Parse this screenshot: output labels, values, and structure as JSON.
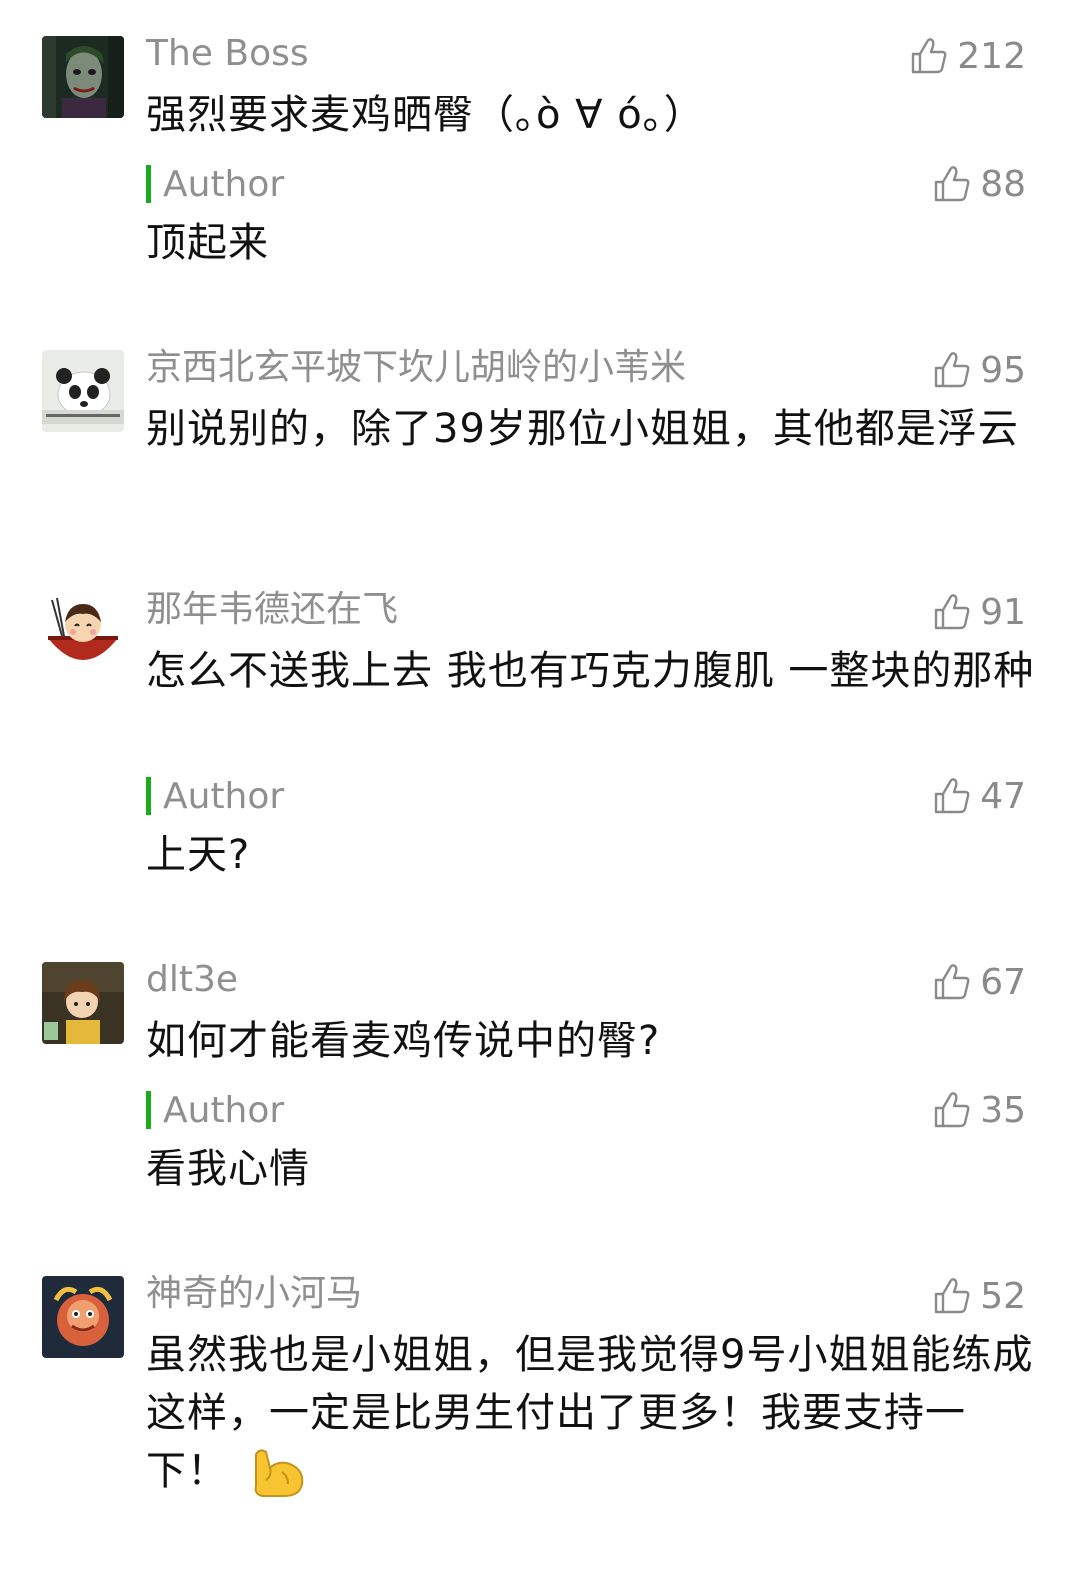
{
  "comments": [
    {
      "name": "The Boss",
      "likes": "212",
      "text": "强烈要求麦鸡晒臀（｡ò ∀ ó｡）",
      "reply": {
        "label": "Author",
        "likes": "88",
        "text": "顶起来"
      },
      "avatar_icon": "joker-avatar"
    },
    {
      "name": "京西北玄平坡下坎儿胡岭的小苇米",
      "likes": "95",
      "text": "别说别的，除了39岁那位小姐姐，其他都是浮云",
      "avatar_icon": "panda-avatar"
    },
    {
      "name": "那年韦德还在飞",
      "likes": "91",
      "text": "怎么不送我上去 我也有巧克力腹肌 一整块的那种",
      "reply": {
        "label": "Author",
        "likes": "47",
        "text": "上天?"
      },
      "avatar_icon": "noodle-girl-avatar"
    },
    {
      "name": "dlt3e",
      "likes": "67",
      "text": "如何才能看麦鸡传说中的臀?",
      "reply": {
        "label": "Author",
        "likes": "35",
        "text": "看我心情"
      },
      "avatar_icon": "anime-girl-avatar"
    },
    {
      "name": "神奇的小河马",
      "likes": "52",
      "text": "虽然我也是小姐姐，但是我觉得9号小姐姐能练成这样，一定是比男生付出了更多！我要支持一下！",
      "avatar_icon": "cartoon-avatar"
    }
  ],
  "colors": {
    "author_bar": "#1aad19",
    "meta_text": "#8f8f8f",
    "body_text": "#111111"
  },
  "icons": {
    "like": "thumbs-up-icon",
    "emoji": "flexed-biceps-icon"
  }
}
